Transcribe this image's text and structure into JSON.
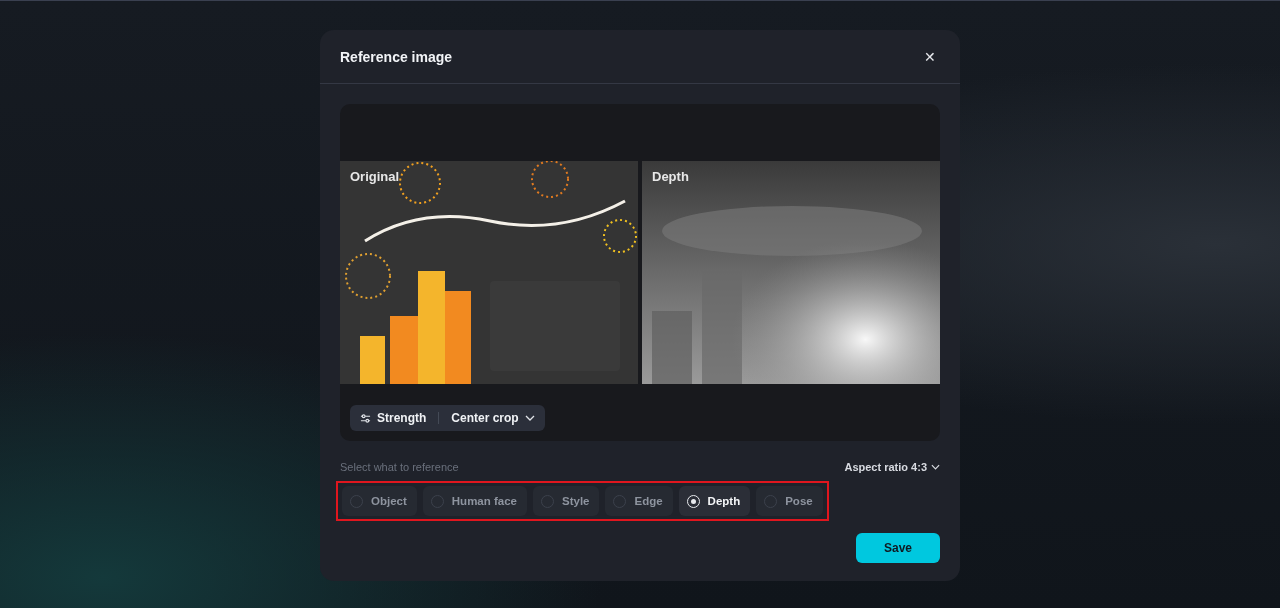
{
  "dialog": {
    "title": "Reference image",
    "close_label": "✕"
  },
  "preview": {
    "panels": [
      {
        "label": "Original",
        "kind": "original"
      },
      {
        "label": "Depth",
        "kind": "depth"
      }
    ],
    "toolbar": {
      "strength_label": "Strength",
      "crop_label": "Center crop"
    }
  },
  "reference": {
    "prompt": "Select what to reference",
    "aspect_ratio": "Aspect ratio 4:3",
    "highlighted": true,
    "options": [
      {
        "label": "Object",
        "selected": false
      },
      {
        "label": "Human face",
        "selected": false
      },
      {
        "label": "Style",
        "selected": false
      },
      {
        "label": "Edge",
        "selected": false
      },
      {
        "label": "Depth",
        "selected": true
      },
      {
        "label": "Pose",
        "selected": false
      }
    ]
  },
  "save_label": "Save"
}
